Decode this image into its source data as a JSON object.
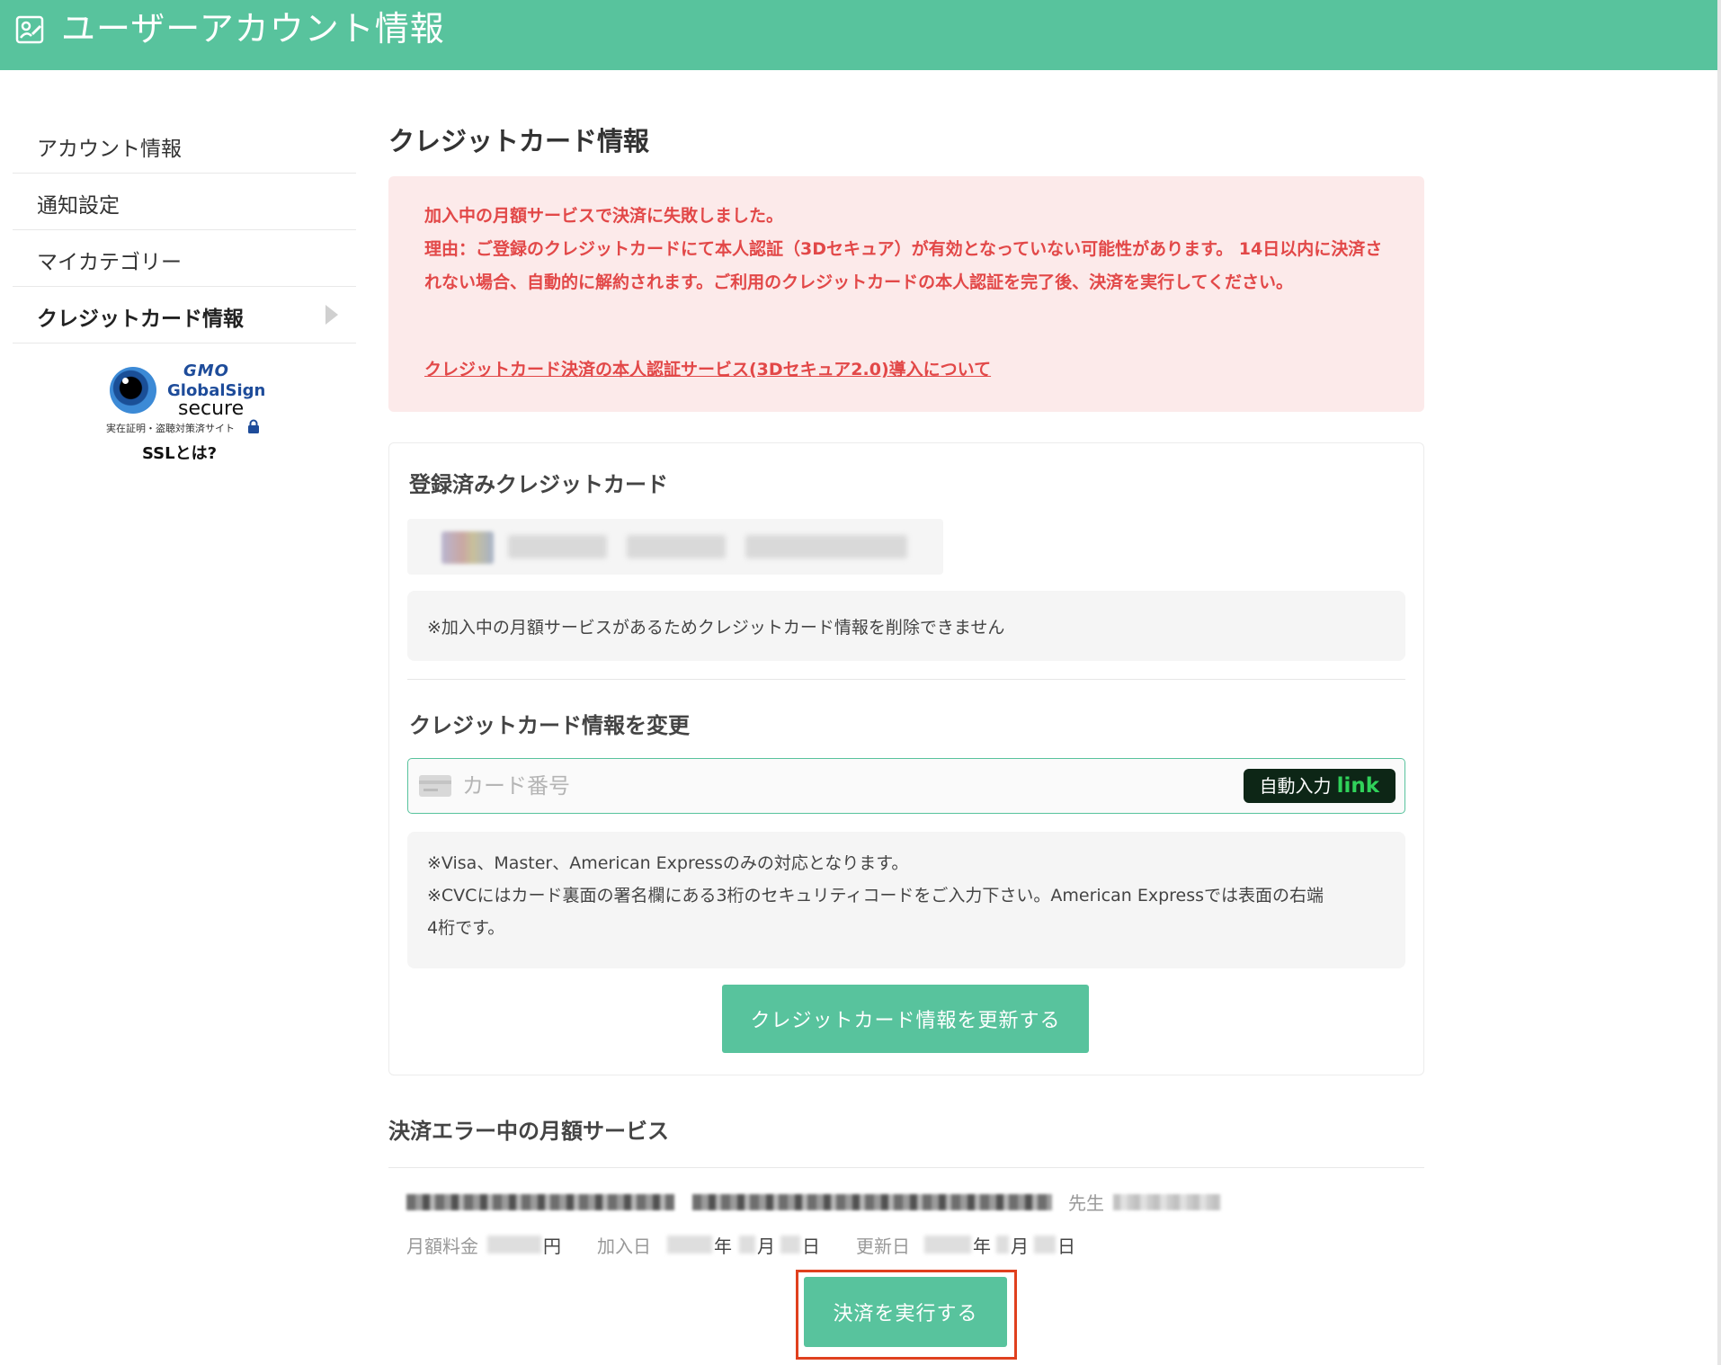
{
  "header": {
    "title": "ユーザーアカウント情報",
    "icon": "account-edit-icon",
    "color": "#58c39d"
  },
  "sidebar": {
    "items": [
      {
        "label": "アカウント情報",
        "active": false
      },
      {
        "label": "通知設定",
        "active": false
      },
      {
        "label": "マイカテゴリー",
        "active": false
      },
      {
        "label": "クレジットカード情報",
        "active": true
      }
    ],
    "ssl_badge": {
      "brand": "GMO",
      "name": "GlobalSign",
      "secure": "secure",
      "sub": "実在証明・盗聴対策済サイト",
      "link": "SSLとは?"
    }
  },
  "main": {
    "title": "クレジットカード情報",
    "alert": {
      "line1": "加入中の月額サービスで決済に失敗しました。",
      "line2": "理由：ご登録のクレジットカードにて本人認証（3Dセキュア）が有効となっていない可能性があります。 14日以内に決済されない場合、自動的に解約されます。ご利用のクレジットカードの本人認証を完了後、決済を実行してください。",
      "link": "クレジットカード決済の本人認証サービス(3Dセキュア2.0)導入について",
      "color": "#e24848"
    },
    "registered": {
      "title": "登録済みクレジットカード",
      "note": "※加入中の月額サービスがあるためクレジットカード情報を削除できません"
    },
    "change": {
      "title": "クレジットカード情報を変更",
      "card_placeholder": "カード番号",
      "autofill_label": "自動入力",
      "autofill_brand": "link",
      "info": [
        "※Visa、Master、American Expressのみの対応となります。",
        "※CVCにはカード裏面の署名欄にある3桁のセキュリティコードをご入力下さい。American Expressでは表面の右端",
        "4桁です。"
      ],
      "update_button": "クレジットカード情報を更新する"
    },
    "error_services": {
      "title": "決済エラー中の月額サービス",
      "teacher_label": "先生",
      "fee_label": "月額料金",
      "fee_unit": "円",
      "joined_label": "加入日",
      "updated_label": "更新日",
      "year": "年",
      "month": "月",
      "day": "日",
      "pay_button": "決済を実行する"
    }
  }
}
